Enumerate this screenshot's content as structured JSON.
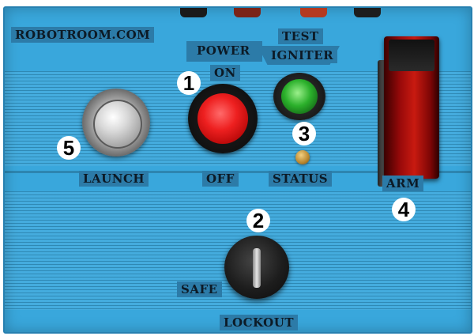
{
  "brand": "ROBOTROOM.COM",
  "labels": {
    "power_line1": "POWER",
    "power_line2": "ON",
    "test_line1": "TEST",
    "test_line2": "IGNITER",
    "launch": "LAUNCH",
    "off": "OFF",
    "status": "STATUS",
    "arm": "ARM",
    "safe": "SAFE",
    "lockout": "LOCKOUT"
  },
  "markers": {
    "power": "1",
    "lockout": "2",
    "status": "3",
    "arm": "4",
    "launch": "5"
  },
  "colors": {
    "panel": "#39a7dc",
    "power_lens": "#ee2020",
    "test_lens": "#2bb02b",
    "arm_cover": "#c81a10",
    "status_led": "#b8862e"
  }
}
